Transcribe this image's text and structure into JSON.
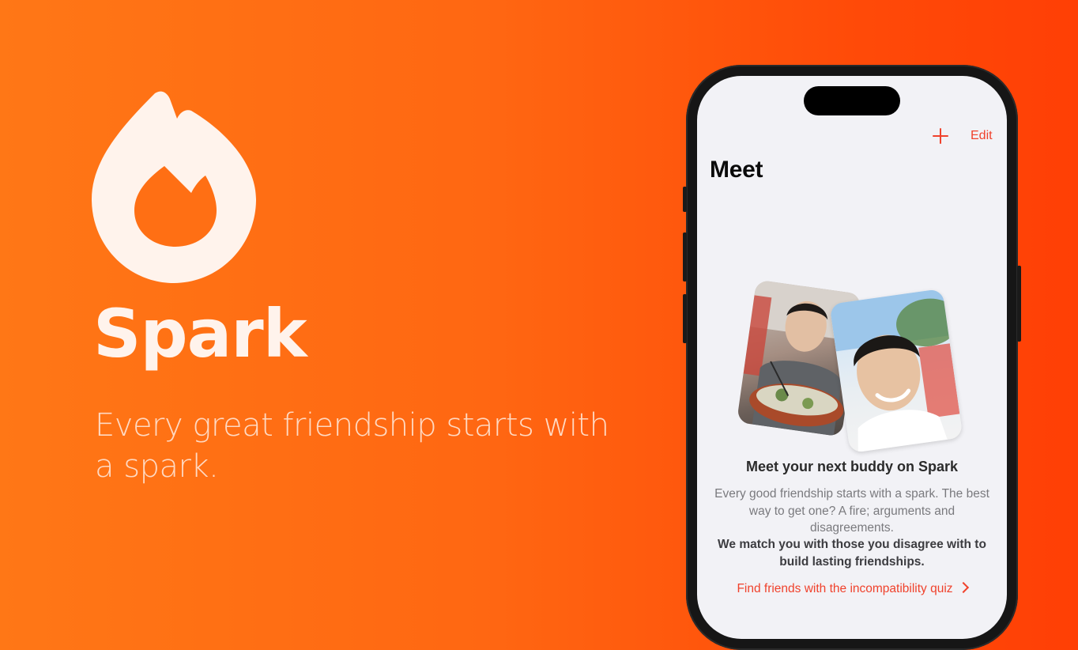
{
  "hero": {
    "app_name": "Spark",
    "tagline": "Every great friendship starts with a spark.",
    "logo_icon": "flame-icon"
  },
  "colors": {
    "background_start": "#ff7716",
    "background_end": "#ff3f05",
    "accent": "#f0422c",
    "logo_fill": "#fff3ec"
  },
  "phone": {
    "nav": {
      "add_icon": "plus-icon",
      "edit_label": "Edit"
    },
    "title": "Meet",
    "onboarding": {
      "title": "Meet your next buddy on Spark",
      "body": "Every good friendship starts with a spark. The best way to get one? A fire; arguments and disagreements.",
      "emphasis": "We match you with those you disagree with to build lasting friendships.",
      "link_label": "Find friends with the incompatibility quiz",
      "link_icon": "chevron-right-icon"
    }
  }
}
